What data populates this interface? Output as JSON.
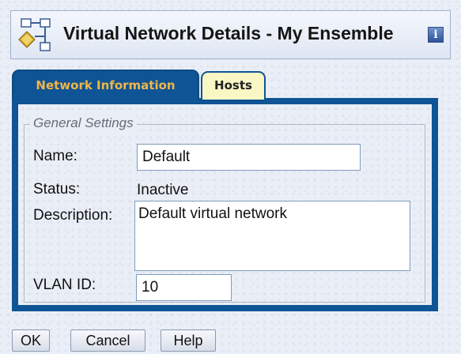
{
  "header": {
    "title": "Virtual Network Details - My Ensemble",
    "icon": "network-topology-icon",
    "info_icon": "info-icon",
    "info_glyph": "i"
  },
  "tabs": [
    {
      "label": "Network Information",
      "active": true
    },
    {
      "label": "Hosts",
      "active": false
    }
  ],
  "form": {
    "section_title": "General Settings",
    "name_label": "Name:",
    "name_value": "Default",
    "status_label": "Status:",
    "status_value": "Inactive",
    "description_label": "Description:",
    "description_value": "Default virtual network",
    "vlan_label": "VLAN ID:",
    "vlan_value": "10"
  },
  "buttons": {
    "ok": "OK",
    "cancel": "Cancel",
    "help": "Help"
  },
  "colors": {
    "tab_active_bg": "#0f5494",
    "tab_active_text": "#f0b64a",
    "tab_inactive_bg": "#f9f7c4",
    "panel_border": "#0f5494"
  }
}
